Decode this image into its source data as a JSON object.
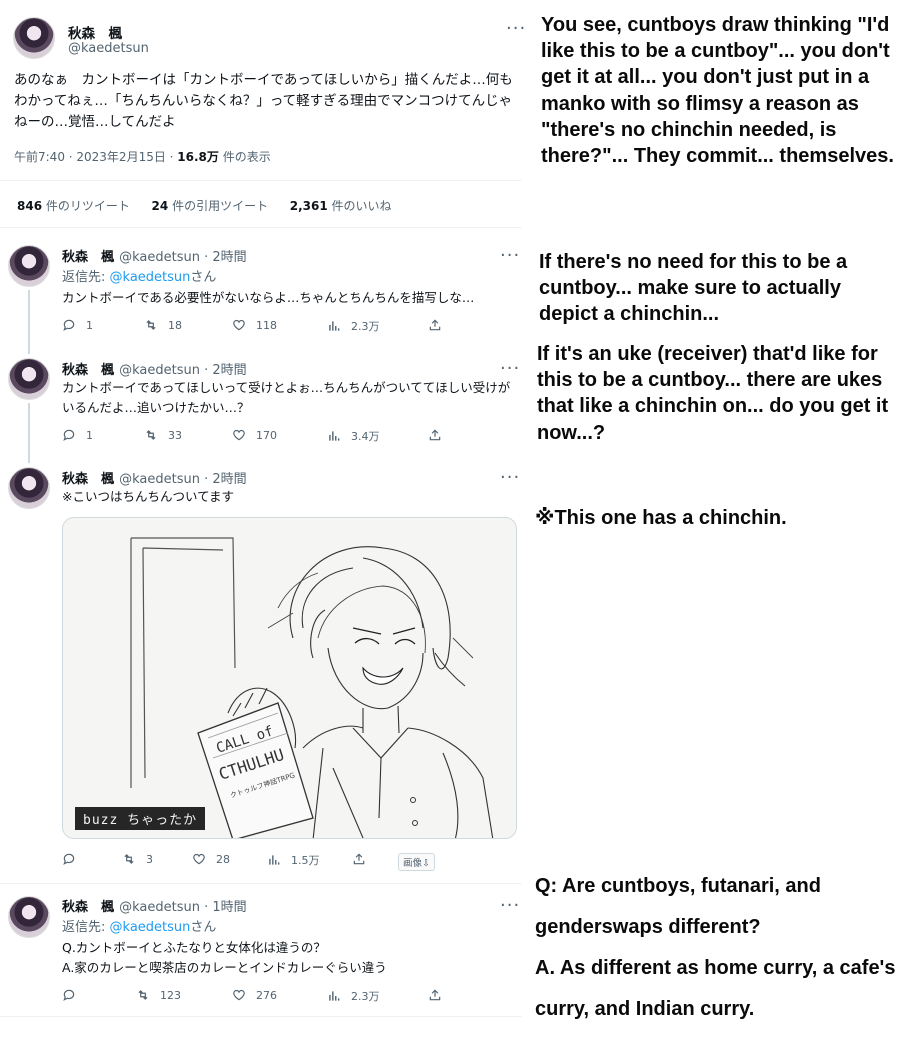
{
  "main_tweet": {
    "author_name": "秋森　楓",
    "author_handle": "@kaedetsun",
    "text": "あのなぁ　カントボーイは「カントボーイであってほしいから」描くんだよ…何もわかってねぇ…「ちんちんいらなくね？」って軽すぎる理由でマンコつけてんじゃねーの…覚悟…してんだよ",
    "timestamp": "午前7:40 · 2023年2月15日 · ",
    "views_value": "16.8万",
    "views_label": " 件の表示",
    "retweets_value": "846",
    "retweets_label": " 件のリツイート",
    "quotes_value": "24",
    "quotes_label": " 件の引用ツイート",
    "likes_value": "2,361",
    "likes_label": " 件のいいね",
    "more_icon": "more-icon"
  },
  "replies": [
    {
      "author_name": "秋森　楓",
      "handle_time": "@kaedetsun · 2時間",
      "reply_to_prefix": "返信先: ",
      "reply_to_handle": "@kaedetsun",
      "reply_to_suffix": "さん",
      "text": "カントボーイである必要性がないならよ…ちゃんとちんちんを描写しな…",
      "replies": "1",
      "retweets": "18",
      "likes": "118",
      "views": "2.3万"
    },
    {
      "author_name": "秋森　楓",
      "handle_time": "@kaedetsun · 2時間",
      "text": "カントボーイであってほしいって受けとよぉ…ちんちんがついててほしい受けがいるんだよ…追いつけたかい…？",
      "replies": "1",
      "retweets": "33",
      "likes": "170",
      "views": "3.4万"
    },
    {
      "author_name": "秋森　楓",
      "handle_time": "@kaedetsun · 2時間",
      "text": "※こいつはちんちんついてます",
      "image_tag": "buzz ちゃったか",
      "image_cover_text_1": "CALL of",
      "image_cover_text_2": "CTHULHU",
      "image_cover_text_3": "クトゥルフ神話TRPG",
      "replies": "",
      "retweets": "3",
      "likes": "28",
      "views": "1.5万",
      "image_button": "画像⇩"
    },
    {
      "author_name": "秋森　楓",
      "handle_time": "@kaedetsun · 1時間",
      "reply_to_prefix": "返信先: ",
      "reply_to_handle": "@kaedetsun",
      "reply_to_suffix": "さん",
      "text_line1": "Q.カントボーイとふたなりと女体化は違うの？",
      "text_line2": "A.家のカレーと喫茶店のカレーとインドカレーぐらい違う",
      "replies": "",
      "retweets": "123",
      "likes": "276",
      "views": "2.3万"
    }
  ],
  "captions": {
    "c1": "You see, cuntboys draw thinking \"I'd like this to be a cuntboy\"... you don't get it at all... you don't just put in a manko with so flimsy a reason as \"there's no chinchin needed, is there?\"... They commit... themselves.",
    "c2": "If there's no need for this to be a cuntboy... make sure to actually depict a chinchin...",
    "c3": "If it's an uke (receiver) that'd like for this to be a cuntboy... there are ukes that like a chinchin on... do you get it now...?",
    "c4": "※This one has a chinchin.",
    "c5_line1": "Q: Are cuntboys, futanari, and genderswaps different?",
    "c5_line2": "A. As different as home curry, a cafe's curry, and Indian curry."
  },
  "colors": {
    "accent": "#1d9bf0",
    "muted": "#536471",
    "text": "#0f1419",
    "divider": "#eff3f4"
  }
}
